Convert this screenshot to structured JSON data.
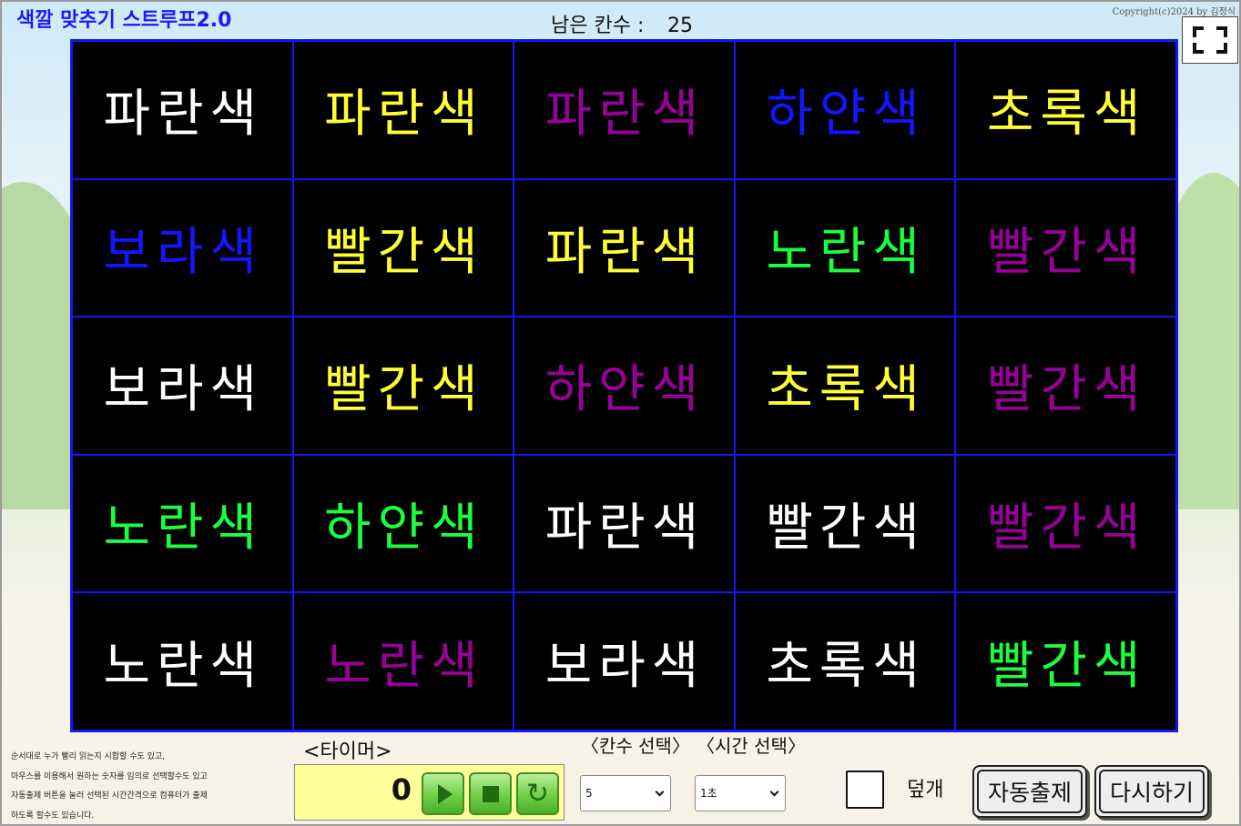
{
  "header": {
    "app_title": "색깔 맞추기 스트루프2.0",
    "remaining_label": "남은 칸수 :",
    "remaining_count": "25",
    "copyright": "Copyright(c)2024 by 김정식",
    "fullscreen_icon": "fullscreen-icon"
  },
  "colors": {
    "board_bg": "#000000",
    "grid_line": "#1414ff",
    "white": "#ffffff",
    "yellow": "#ffff33",
    "purple": "#990099",
    "blue": "#1414ff",
    "green": "#1aff3c"
  },
  "board": {
    "rows": [
      [
        {
          "word": "파란색",
          "color": "#ffffff"
        },
        {
          "word": "파란색",
          "color": "#ffff33"
        },
        {
          "word": "파란색",
          "color": "#990099"
        },
        {
          "word": "하얀색",
          "color": "#1414ff"
        },
        {
          "word": "초록색",
          "color": "#ffff33"
        }
      ],
      [
        {
          "word": "보라색",
          "color": "#1414ff"
        },
        {
          "word": "빨간색",
          "color": "#ffff33"
        },
        {
          "word": "파란색",
          "color": "#ffff33"
        },
        {
          "word": "노란색",
          "color": "#1aff3c"
        },
        {
          "word": "빨간색",
          "color": "#990099"
        }
      ],
      [
        {
          "word": "보라색",
          "color": "#ffffff"
        },
        {
          "word": "빨간색",
          "color": "#ffff33"
        },
        {
          "word": "하얀색",
          "color": "#990099"
        },
        {
          "word": "초록색",
          "color": "#ffff33"
        },
        {
          "word": "빨간색",
          "color": "#990099"
        }
      ],
      [
        {
          "word": "노란색",
          "color": "#1aff3c"
        },
        {
          "word": "하얀색",
          "color": "#1aff3c"
        },
        {
          "word": "파란색",
          "color": "#ffffff"
        },
        {
          "word": "빨간색",
          "color": "#ffffff"
        },
        {
          "word": "빨간색",
          "color": "#990099"
        }
      ],
      [
        {
          "word": "노란색",
          "color": "#ffffff"
        },
        {
          "word": "노란색",
          "color": "#990099"
        },
        {
          "word": "보라색",
          "color": "#ffffff"
        },
        {
          "word": "초록색",
          "color": "#ffffff"
        },
        {
          "word": "빨간색",
          "color": "#1aff3c"
        }
      ]
    ]
  },
  "instructions": {
    "lines": [
      "순서대로 누가 빨리 읽는지 시합할 수도 있고,",
      "마우스를 이용해서 원하는 숫자를 임의로 선택할수도 있고",
      "자동출제 버튼을 눌러 선택된 시간간격으로 컴퓨터가 출제",
      "하도록 할수도 있습니다."
    ]
  },
  "timer": {
    "title": "<타이머>",
    "value": "0",
    "play_icon": "play-icon",
    "stop_icon": "stop-icon",
    "reset_icon": "reset-icon"
  },
  "selectors": {
    "cells_label": "〈칸수 선택〉",
    "cells_value": "5",
    "time_label": "〈시간 선택〉",
    "time_value": "1초"
  },
  "controls": {
    "cover_label": "덮개",
    "cover_checked": false,
    "auto_button": "자동출제",
    "restart_button": "다시하기"
  }
}
